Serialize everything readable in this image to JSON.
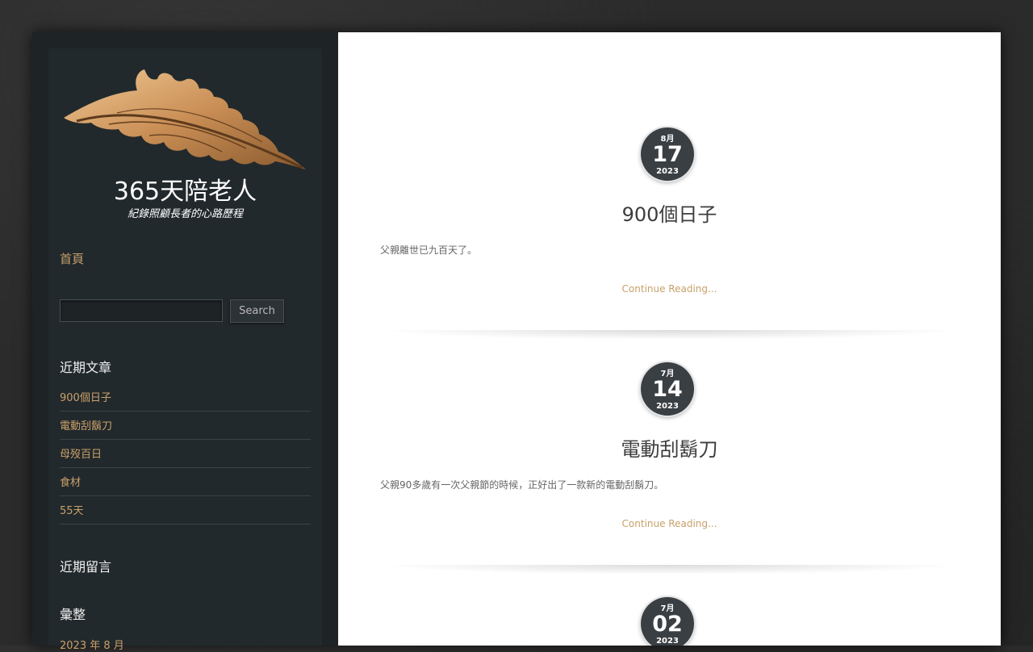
{
  "site": {
    "title": "365天陪老人",
    "tagline": "紀錄照顧長者的心路歷程"
  },
  "nav": {
    "home": "首頁"
  },
  "search": {
    "button": "Search",
    "placeholder": ""
  },
  "widgets": {
    "recent_posts_title": "近期文章",
    "recent_posts": [
      "900個日子",
      "電動刮鬍刀",
      "母歿百日",
      "食材",
      "55天"
    ],
    "recent_comments_title": "近期留言",
    "archives_title": "彙整",
    "archives": [
      "2023 年 8 月"
    ]
  },
  "posts": [
    {
      "month": "8月",
      "day": "17",
      "year": "2023",
      "title": "900個日子",
      "excerpt": "父親離世已九百天了。",
      "more": "Continue Reading..."
    },
    {
      "month": "7月",
      "day": "14",
      "year": "2023",
      "title": "電動刮鬍刀",
      "excerpt": "父親90多歲有一次父親節的時候，正好出了一款新的電動刮鬍刀。",
      "more": "Continue Reading..."
    },
    {
      "month": "7月",
      "day": "02",
      "year": "2023"
    }
  ],
  "colors": {
    "accent": "#c8a06a",
    "sidebar": "#22292c",
    "badge": "#3a3f43"
  },
  "icons": {
    "logo": "golden-feather-leaf-logo"
  }
}
